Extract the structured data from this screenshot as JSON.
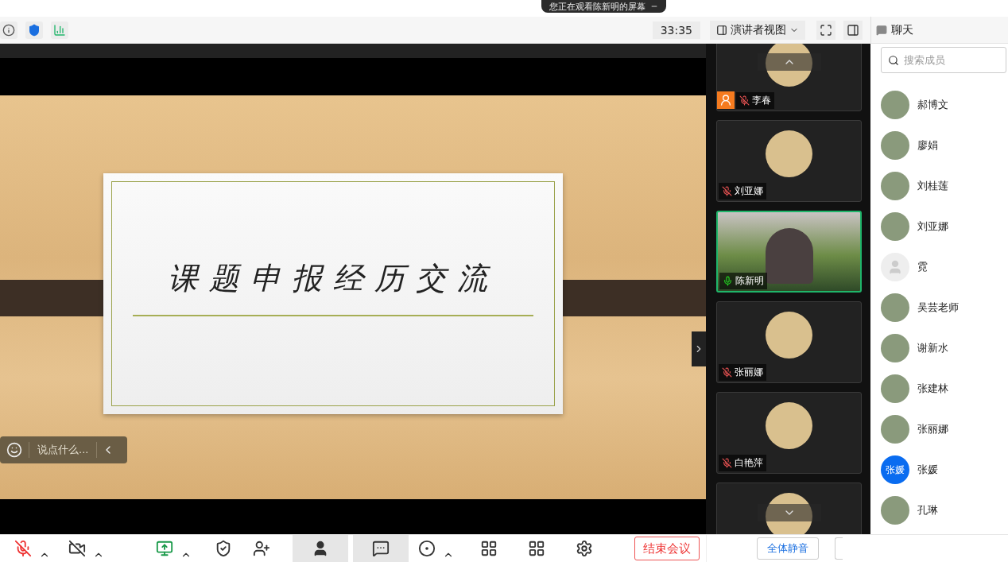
{
  "banner": {
    "text": "您正在观看陈新明的屏幕"
  },
  "toolbar": {
    "timer": "33:35",
    "view": "演讲者视图"
  },
  "chat_header": {
    "title": "聊天"
  },
  "slide": {
    "title": "课题申报经历交流"
  },
  "comment_box": {
    "placeholder": "说点什么..."
  },
  "video_tiles": [
    {
      "name": "李春",
      "kind": "avatar",
      "muted": true,
      "badge": true,
      "selected": false
    },
    {
      "name": "刘亚娜",
      "kind": "avatar",
      "muted": true,
      "badge": false,
      "selected": false
    },
    {
      "name": "陈新明",
      "kind": "video",
      "muted": false,
      "badge": false,
      "selected": true
    },
    {
      "name": "张丽娜",
      "kind": "avatar",
      "muted": true,
      "badge": false,
      "selected": false
    },
    {
      "name": "白艳萍",
      "kind": "avatar",
      "muted": true,
      "badge": false,
      "selected": false
    },
    {
      "kind": "avatar",
      "selected": false
    }
  ],
  "members": {
    "search_placeholder": "搜索成员",
    "items": [
      {
        "name": "郝博文",
        "kind": "photo"
      },
      {
        "name": "廖娟",
        "kind": "photo"
      },
      {
        "name": "刘桂莲",
        "kind": "photo"
      },
      {
        "name": "刘亚娜",
        "kind": "photo"
      },
      {
        "name": "霓",
        "kind": "default"
      },
      {
        "name": "吴芸老师",
        "kind": "photo"
      },
      {
        "name": "谢新水",
        "kind": "photo"
      },
      {
        "name": "张建林",
        "kind": "photo"
      },
      {
        "name": "张丽娜",
        "kind": "photo"
      },
      {
        "name": "张媛",
        "kind": "initials",
        "initials": "张媛"
      },
      {
        "name": "孔琳",
        "kind": "photo"
      }
    ],
    "mute_all": "全体静音"
  },
  "controls": [
    {
      "kind": "microphone",
      "off": true,
      "menu": true,
      "selected": false
    },
    {
      "kind": "camera",
      "off": true,
      "menu": true,
      "selected": false
    },
    {
      "kind": "share",
      "menu": true,
      "selected": false
    },
    {
      "kind": "security",
      "menu": false,
      "selected": false
    },
    {
      "kind": "invite",
      "menu": false,
      "selected": false
    },
    {
      "kind": "members",
      "menu": false,
      "selected": true
    },
    {
      "kind": "chat",
      "menu": false,
      "selected": true
    },
    {
      "kind": "record",
      "menu": true,
      "selected": false
    },
    {
      "kind": "layout",
      "menu": false,
      "selected": false
    },
    {
      "kind": "apps",
      "menu": false,
      "selected": false
    },
    {
      "kind": "settings",
      "menu": false,
      "selected": false
    }
  ],
  "end_button": "结束会议"
}
